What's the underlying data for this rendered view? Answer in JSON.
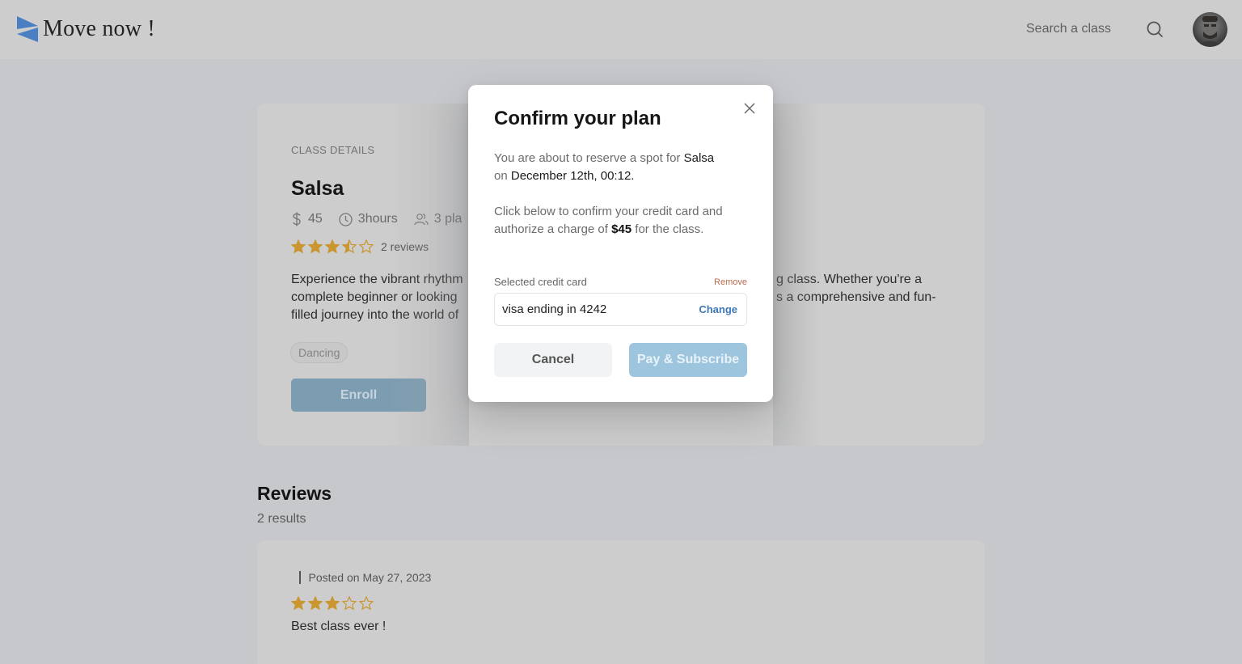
{
  "header": {
    "logo_text": "Move now !",
    "search_label": "Search a class",
    "brand_color": "#4a7fc4"
  },
  "class_details": {
    "section_label": "CLASS DETAILS",
    "title": "Salsa",
    "price": "45",
    "duration": "3hours",
    "places_partial": "3 pla",
    "rating": 3.5,
    "rating_max": 5,
    "reviews_label": "2 reviews",
    "description_lines": [
      {
        "left": "Experience the vibrant rhythm",
        "right": "g class. Whether you're a"
      },
      {
        "left": "complete beginner or looking",
        "right": "s a comprehensive and fun-"
      },
      {
        "left": "filled journey into the world of",
        "right": ""
      }
    ],
    "tag": "Dancing",
    "enroll_label": "Enroll"
  },
  "reviews": {
    "title": "Reviews",
    "results": "2 results",
    "items": [
      {
        "posted": "Posted on May 27, 2023",
        "rating": 3,
        "text": "Best class ever !"
      }
    ]
  },
  "modal": {
    "title": "Confirm your plan",
    "p1_prefix": "You are about to reserve a spot for ",
    "p1_class": "Salsa",
    "p1_on": "on ",
    "p1_date": "December 12th, 00:12",
    "p1_suffix": ".",
    "p2_prefix": "Click below to confirm your credit card and authorize a charge of ",
    "p2_amount": "$45",
    "p2_suffix": " for the class.",
    "card_label": "Selected credit card",
    "remove_label": "Remove",
    "card_value": "visa ending in 4242",
    "change_label": "Change",
    "cancel_label": "Cancel",
    "pay_label": "Pay & Subscribe"
  }
}
